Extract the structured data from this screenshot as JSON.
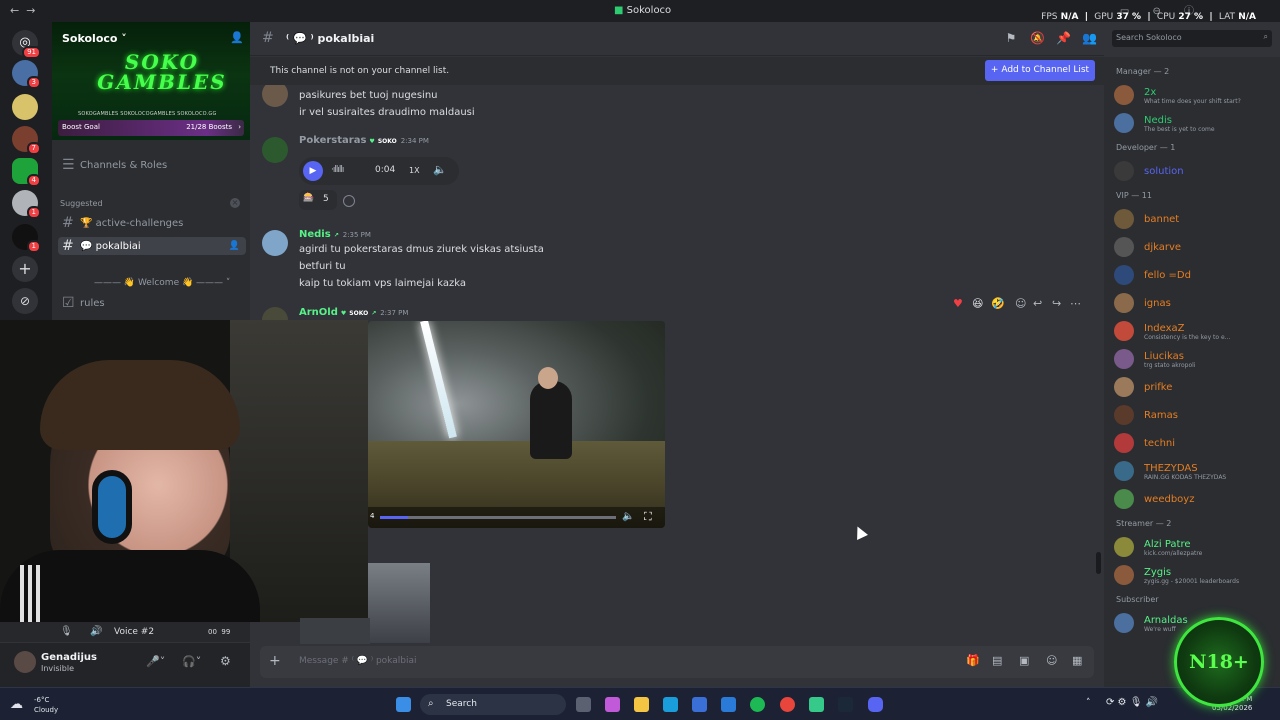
{
  "window": {
    "title": "Sokoloco",
    "fps_label": "FPS",
    "fps_value": "N/A",
    "gpu_label": "GPU",
    "gpu_value": "37",
    "cpu_label": "CPU",
    "cpu_value": "27",
    "lat_label": "LAT",
    "lat_value": "N/A"
  },
  "rail": {
    "badges": [
      "91",
      "3",
      "7",
      "4",
      "1",
      "1"
    ]
  },
  "server": {
    "name": "Sokoloco",
    "banner_text": "SOKO GAMBLES",
    "socials": "SOKOGAMBLES  SOKOLOCOGAMBLES  SOKOLOCO.GG",
    "boost_label": "Boost Goal",
    "boost_progress": "21/28 Boosts",
    "boost_fraction": 0.75,
    "channels_roles": "Channels & Roles",
    "suggested_label": "Suggested",
    "channels": [
      {
        "label": "active-challenges",
        "emoji": "🏆"
      },
      {
        "label": "pokalbiai",
        "emoji": "💬"
      }
    ],
    "welcome": "Welcome",
    "rules": "rules"
  },
  "header": {
    "channel": "pokalbiai",
    "search_placeholder": "Search Sokoloco"
  },
  "notice": {
    "text": "This channel is not on your channel list.",
    "button": "Add to Channel List"
  },
  "messages": {
    "prev_lines": [
      "pasikures bet tuoj nugesinu",
      "ir vel susiraites draudimo maldausi"
    ],
    "m1": {
      "author": "Pokerstaras",
      "tag": "SOKO",
      "time": "2:34 PM",
      "duration": "0:04",
      "speed": "1X",
      "reaction_count": "5"
    },
    "m2": {
      "author": "Nedis",
      "time": "2:35 PM",
      "lines": [
        "agirdi tu pokerstaras dmus ziurek viskas atsiusta",
        "betfuri tu",
        "kaip tu tokiam vps laimejai kazka"
      ]
    },
    "m3": {
      "author": "ArnOld",
      "tag": "SOKO",
      "time": "2:37 PM",
      "video_time": "4",
      "video_progress": 0.12
    }
  },
  "composer": {
    "placeholder": "Message #",
    "channel": "pokalbiai"
  },
  "voice": {
    "label": "Voice #2",
    "count_a": "00",
    "count_b": "99"
  },
  "user": {
    "name": "Genadijus",
    "status": "Invisible"
  },
  "members": {
    "groups": [
      {
        "title": "Manager — 2",
        "items": [
          {
            "name": "2x",
            "status": "What time does your shift start?",
            "color": "#2ecc71"
          },
          {
            "name": "Nedis",
            "status": "The best is yet to come",
            "color": "#2ecc71"
          }
        ]
      },
      {
        "title": "Developer — 1",
        "items": [
          {
            "name": "solution",
            "status": "",
            "color": "#5865f2"
          }
        ]
      },
      {
        "title": "VIP — 11",
        "items": [
          {
            "name": "bannet",
            "status": "",
            "color": "#e67e22"
          },
          {
            "name": "djkarve",
            "status": "",
            "color": "#e67e22"
          },
          {
            "name": "fello =Dd",
            "status": "",
            "color": "#e67e22"
          },
          {
            "name": "ignas",
            "status": "",
            "color": "#e67e22"
          },
          {
            "name": "IndexaZ",
            "status": "Consistency is the key to e...",
            "color": "#e67e22"
          },
          {
            "name": "Liucikas",
            "status": "trg stato akropoli",
            "color": "#e67e22"
          },
          {
            "name": "prifke",
            "status": "",
            "color": "#e67e22"
          },
          {
            "name": "Ramas",
            "status": "",
            "color": "#e67e22"
          },
          {
            "name": "techni",
            "status": "",
            "color": "#e67e22"
          },
          {
            "name": "THEZYDAS",
            "status": "RAIN.GG KODAS THEZYDAS",
            "color": "#e67e22"
          },
          {
            "name": "weedboyz",
            "status": "",
            "color": "#e67e22"
          }
        ]
      },
      {
        "title": "Streamer — 2",
        "items": [
          {
            "name": "Alzi Patre",
            "status": "kick.com/allezpatre",
            "color": "#57f287"
          },
          {
            "name": "Zygis",
            "status": "zygis.gg - $20001 leaderboards",
            "color": "#57f287"
          }
        ]
      },
      {
        "title": "Subscriber",
        "items": [
          {
            "name": "Arnaldas",
            "status": "We're wuff",
            "color": "#57f287"
          }
        ]
      }
    ]
  },
  "overlay": {
    "text": "N18+"
  },
  "taskbar": {
    "temp": "-6°C",
    "weather": "Cloudy",
    "search": "Search",
    "time": "5:40 PM",
    "date": "05/02/2026"
  }
}
